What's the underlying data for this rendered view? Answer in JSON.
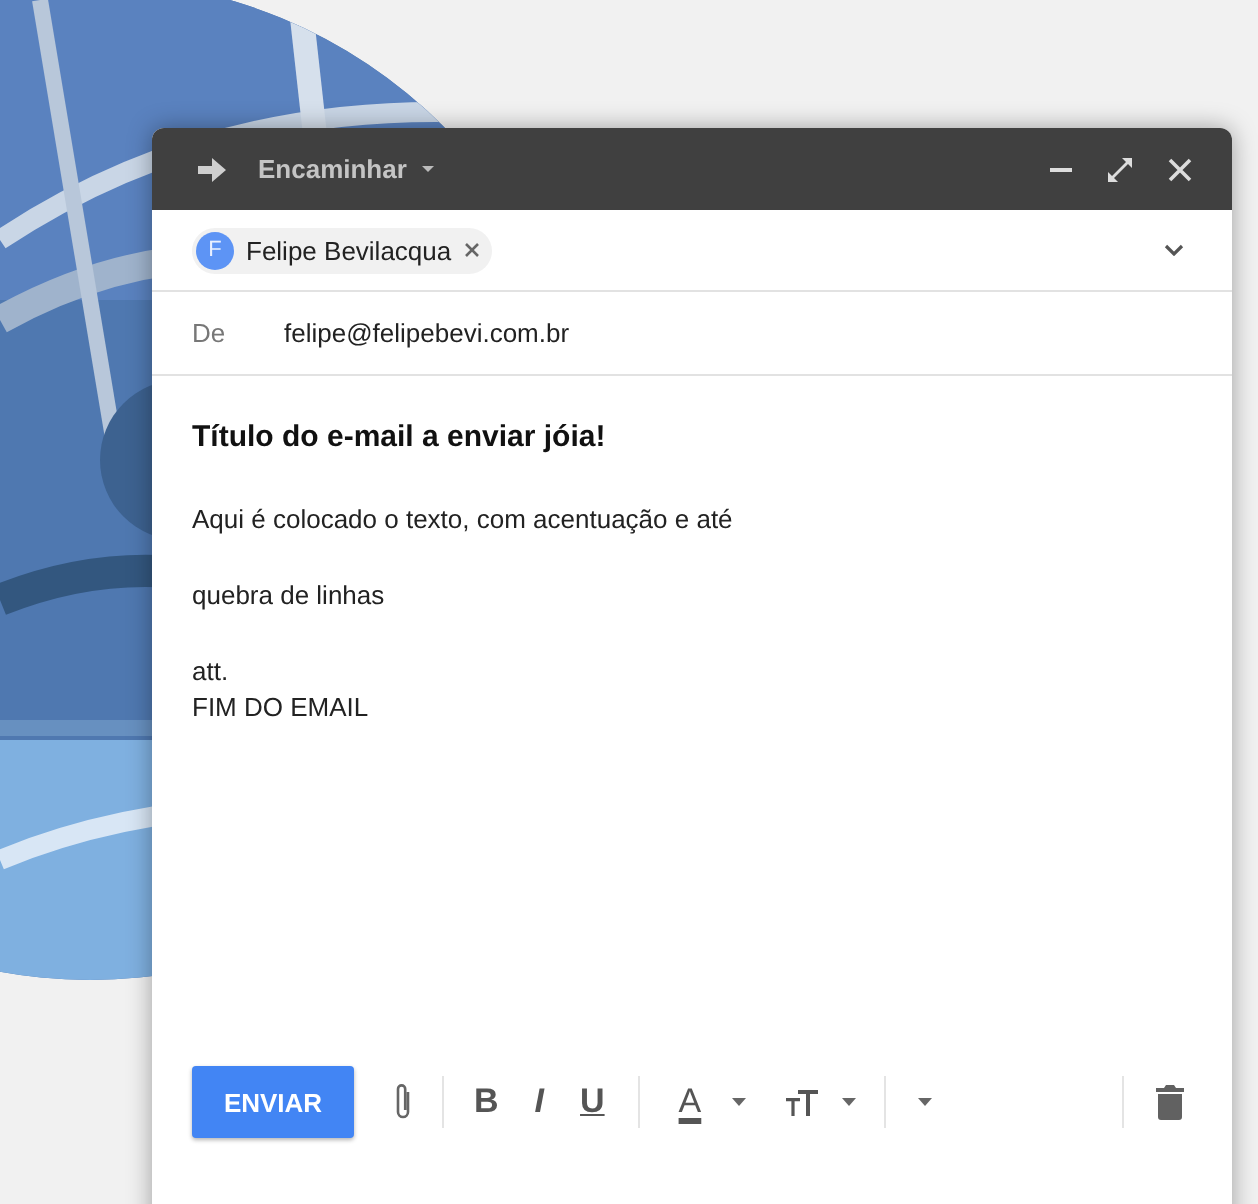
{
  "window": {
    "title": "Encaminhar"
  },
  "recipients": [
    {
      "initial": "F",
      "name": "Felipe Bevilacqua"
    }
  ],
  "from": {
    "label": "De",
    "value": "felipe@felipebevi.com.br"
  },
  "body": {
    "title": "Título do e-mail a enviar jóia!",
    "paragraphs": [
      {
        "lines": [
          "Aqui é colocado o texto, com acentuação e até"
        ]
      },
      {
        "lines": [
          "quebra de linhas"
        ]
      },
      {
        "lines": [
          "att.",
          "FIM DO EMAIL"
        ]
      }
    ]
  },
  "toolbar": {
    "send": "ENVIAR",
    "format": [
      {
        "kind": "bold",
        "label": "B"
      },
      {
        "kind": "italic",
        "label": "I"
      },
      {
        "kind": "underline",
        "label": "U"
      }
    ],
    "color_label": "A"
  }
}
